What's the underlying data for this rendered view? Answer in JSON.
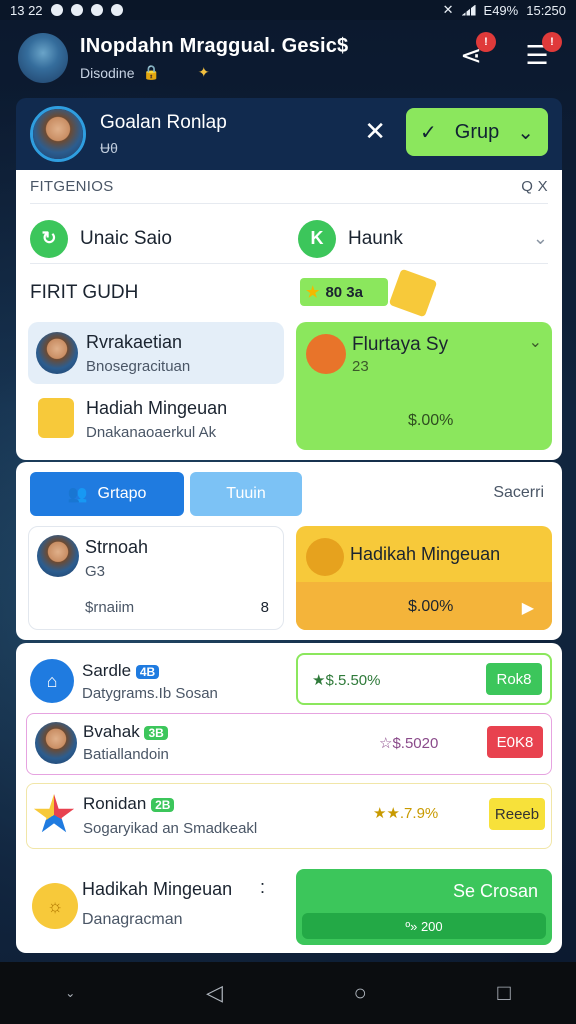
{
  "status": {
    "time_left": "13 22",
    "battery": "E49%",
    "time_right": "15:250"
  },
  "topbar": {
    "title": "INopdahn Mraggual. Gesic$",
    "subtitle": "Disodine",
    "notif_badge": "!",
    "menu_badge": "!"
  },
  "header": {
    "name": "Goalan Ronlap",
    "sub": "Ʉθ",
    "group_btn": "Grup"
  },
  "search": {
    "label": "FITGENIOS",
    "icons": "Q X"
  },
  "users_row": {
    "left": "Unaic Saio",
    "right": "Haunk"
  },
  "first": {
    "title": "FIRIT GUDH",
    "points": "80 3a"
  },
  "card_a": {
    "name": "Rvrakaetian",
    "sub": "Bnosegracituan"
  },
  "card_b": {
    "name": "Hadiah Mingeuan",
    "sub": "Dnakanaoaerkul Ak"
  },
  "card_green": {
    "name": "Flurtaya Sy",
    "sub": "23",
    "value": "$.00%"
  },
  "sec2": {
    "btn_group": "Grtapo",
    "btn_join": "Tuuin",
    "search": "Sacerri"
  },
  "card_c": {
    "name": "Strnoah",
    "sub": "G3",
    "footer": "$rnaiim",
    "close": "8"
  },
  "card_yellow": {
    "name": "Hadikah Mingeuan",
    "value": "$.00%"
  },
  "list": [
    {
      "name": "Sardle",
      "tag": "4B",
      "sub": "Datygrams.Ib Sosan",
      "stat": "★$.5.50%",
      "action": "Rok8"
    },
    {
      "name": "Bvahak",
      "tag": "3B",
      "sub": "Batiallandoin",
      "stat": "☆$.5020",
      "action": "E0K8"
    },
    {
      "name": "Ronidan",
      "tag": "2B",
      "sub": "Sogaryikad an Smadkeakl",
      "stat": "★★.7.9%",
      "action": "Reeeb"
    }
  ],
  "bottom_card": {
    "name": "Hadikah Mingeuan",
    "sub": "Danagracman",
    "btn": "Se Crosan",
    "amount": "º» 200"
  },
  "colors": {
    "green": "#8be75d",
    "navy": "#112a4e",
    "blue": "#1f7be0",
    "yellow": "#f7c93a",
    "red": "#e8424f"
  }
}
